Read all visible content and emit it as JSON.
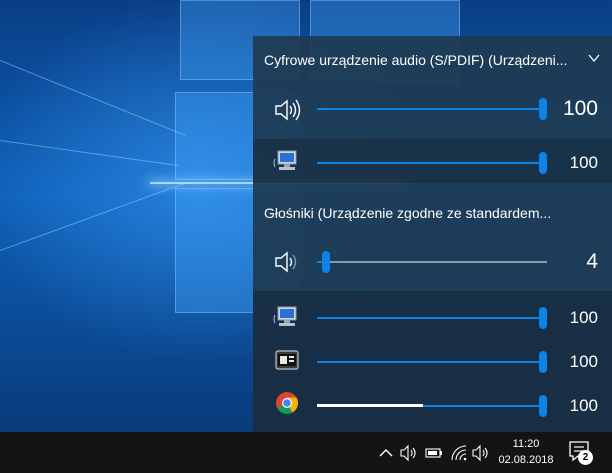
{
  "flyout": {
    "device1": {
      "name": "Cyfrowe urządzenie audio (S/PDIF) (Urządzeni...",
      "master": {
        "value": "100",
        "level": 100,
        "icon": "speaker-icon"
      },
      "apps": [
        {
          "app": "system-sounds",
          "icon": "system-sounds-icon",
          "value": "100",
          "level": 100
        }
      ]
    },
    "device2": {
      "name": "Głośniki (Urządzenie zgodne ze standardem...",
      "master": {
        "value": "4",
        "level": 4,
        "icon": "speaker-low-icon"
      },
      "apps": [
        {
          "app": "system-sounds",
          "icon": "system-sounds-icon",
          "value": "100",
          "level": 100
        },
        {
          "app": "media-app",
          "icon": "media-app-icon",
          "value": "100",
          "level": 100
        },
        {
          "app": "chrome",
          "icon": "chrome-icon",
          "value": "100",
          "level": 100,
          "peak_level": 46
        }
      ]
    }
  },
  "taskbar": {
    "clock": {
      "time": "11:20",
      "date": "02.08.2018"
    },
    "notifications": {
      "count": "2"
    }
  },
  "colors": {
    "accent": "#0a84e8",
    "flyout_bg": "#1e3a52",
    "taskbar_bg": "#141414"
  }
}
